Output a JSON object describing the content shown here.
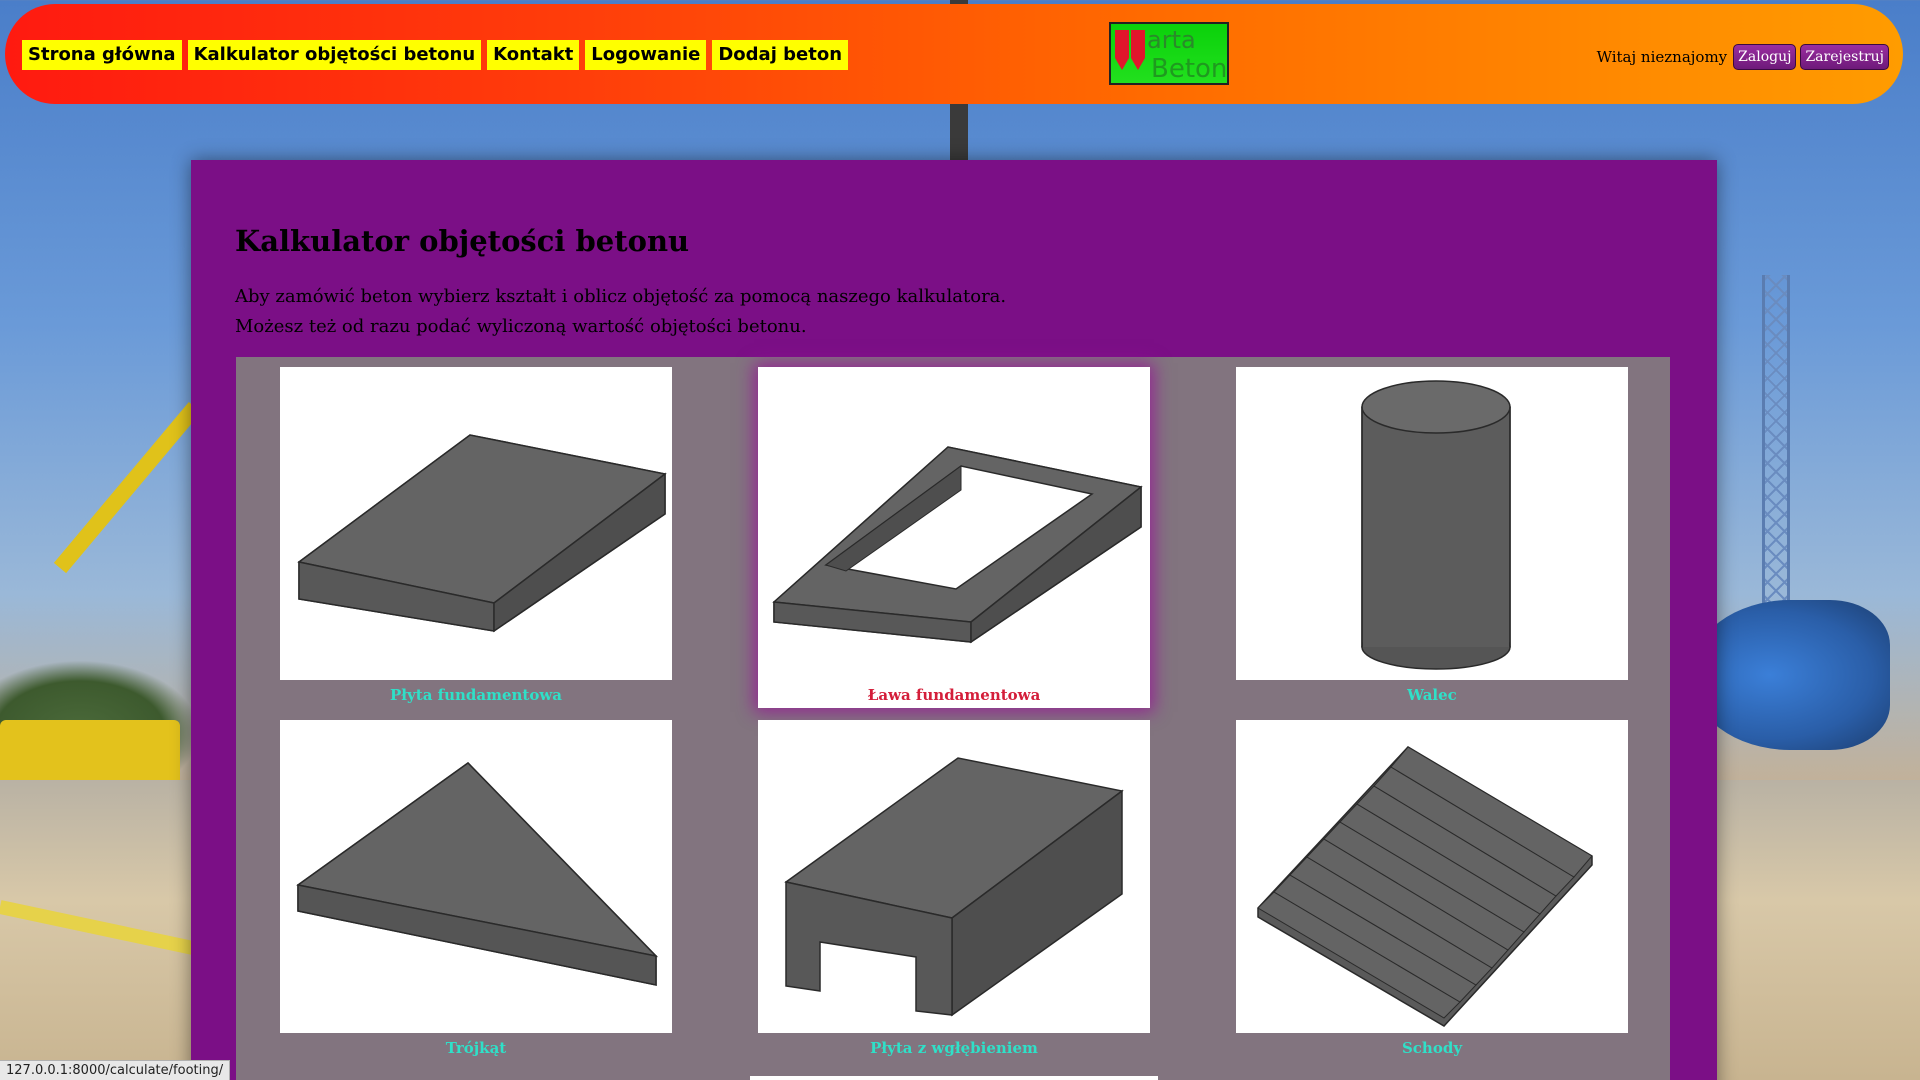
{
  "nav": {
    "items": [
      {
        "label": "Strona główna"
      },
      {
        "label": "Kalkulator objętości betonu"
      },
      {
        "label": "Kontakt"
      },
      {
        "label": "Logowanie"
      },
      {
        "label": "Dodaj beton"
      }
    ]
  },
  "logo": {
    "line1": "arta",
    "line2": "Beton"
  },
  "user": {
    "greeting": "Witaj nieznajomy",
    "login_label": "Zaloguj",
    "register_label": "Zarejestruj"
  },
  "main": {
    "title": "Kalkulator objętości betonu",
    "intro_line1": "Aby zamówić beton wybierz kształt i oblicz objętość za pomocą naszego kalkulatora.",
    "intro_line2": "Możesz też od razu podać wyliczoną wartość objętości betonu.",
    "shapes": [
      {
        "label": "Płyta fundamentowa",
        "icon": "slab-icon"
      },
      {
        "label": "Ława fundamentowa",
        "icon": "footing-icon",
        "active": true
      },
      {
        "label": "Walec",
        "icon": "cylinder-icon"
      },
      {
        "label": "Trójkąt",
        "icon": "triangle-icon"
      },
      {
        "label": "Płyta z wgłębieniem",
        "icon": "recessed-slab-icon"
      },
      {
        "label": "Schody",
        "icon": "stairs-icon"
      }
    ]
  },
  "status_bar": {
    "url": "127.0.0.1:8000/calculate/footing/"
  },
  "colors": {
    "header_start": "#ff1a10",
    "header_end": "#ff9c00",
    "nav_bg": "#ffff00",
    "panel_bg": "#7b0f86",
    "grid_bg": "#82747f",
    "label_color": "#2fe0c8",
    "active_label_color": "#d41e3a"
  }
}
